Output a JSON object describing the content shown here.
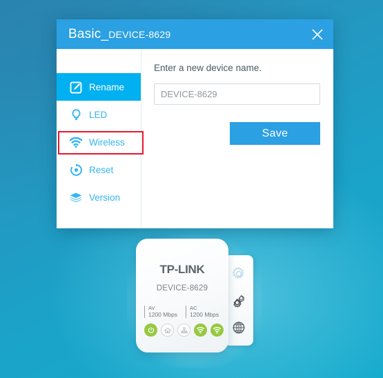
{
  "window": {
    "title_main": "Basic_",
    "title_sub": "DEVICE-8629",
    "close_label": "close-icon",
    "header_color": "#2ba0e2"
  },
  "sidebar": {
    "items": [
      {
        "label": "Rename",
        "icon": "rename-icon",
        "active": true
      },
      {
        "label": "LED",
        "icon": "bulb-icon",
        "active": false
      },
      {
        "label": "Wireless",
        "icon": "wifi-icon",
        "active": false
      },
      {
        "label": "Reset",
        "icon": "reset-icon",
        "active": false
      },
      {
        "label": "Version",
        "icon": "layers-icon",
        "active": false
      }
    ],
    "active_bg": "#00b0f0",
    "text_color": "#35b6ef"
  },
  "annotation": {
    "target": "Wireless",
    "color": "#e8162a"
  },
  "content": {
    "label": "Enter a new device name.",
    "input_value": "",
    "input_placeholder": "DEVICE-8629",
    "save_label": "Save",
    "save_color": "#2ba0e2"
  },
  "device": {
    "brand": "TP-LINK",
    "name": "DEVICE-8629",
    "specs": [
      {
        "standard": "AV",
        "rate": "1200 Mbps"
      },
      {
        "standard": "AC",
        "rate": "1200 Mbps"
      }
    ],
    "leds": [
      {
        "name": "power-led",
        "state": "on"
      },
      {
        "name": "powerline-led",
        "state": "off"
      },
      {
        "name": "ethernet-led",
        "state": "off"
      },
      {
        "name": "wifi-led",
        "state": "on"
      },
      {
        "name": "wifi-clone-led",
        "state": "on"
      }
    ],
    "side_icons": [
      {
        "name": "gear-icon"
      },
      {
        "name": "gears-icon"
      },
      {
        "name": "globe-icon"
      }
    ],
    "led_on_color": "#96c93f"
  },
  "background": {
    "color_top": "#2b87b4",
    "color_bottom": "#15abcd"
  }
}
